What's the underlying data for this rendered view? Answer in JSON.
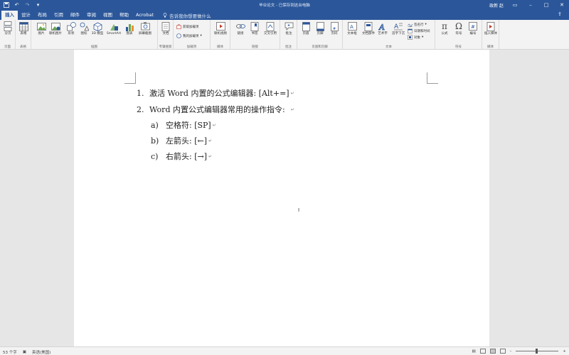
{
  "titlebar": {
    "doc_title": "毕业论文 - 已保存到这台电脑",
    "user": "政新 赵",
    "qat_icons": [
      "save-icon",
      "undo-icon",
      "redo-icon",
      "customize-icon"
    ]
  },
  "tabs": [
    "插入",
    "设计",
    "布局",
    "引用",
    "邮件",
    "审阅",
    "视图",
    "帮助",
    "Acrobat"
  ],
  "active_tab": "插入",
  "tellme": "告诉我你想要做什么",
  "ribbon": {
    "groups": {
      "pages": "页面",
      "tables": "表格",
      "illustrations": "插图",
      "addins": "加载项",
      "media": "媒体",
      "links": "链接",
      "comments": "批注",
      "header_footer": "页眉和页脚",
      "text": "文本",
      "symbols": "符号",
      "embed": "媒体",
      "acrobat_addins": "专辑搜索"
    },
    "buttons": {
      "pages": "分页",
      "table": "表格",
      "pictures": "图片",
      "online_pictures": "联机图片",
      "shapes": "形状",
      "icons": "图标",
      "models": "3D 模型",
      "smartart": "SmartArt",
      "chart": "图表",
      "screenshot": "屏幕截图",
      "docs": "文档",
      "get_addins": "获取加载项",
      "my_addins": "我的加载项",
      "online_video": "联机视频",
      "link": "链接",
      "bookmark": "书签",
      "cross_ref": "交叉引用",
      "comment": "批注",
      "header": "页眉",
      "footer": "页脚",
      "page_number": "页码",
      "textbox": "文本框",
      "quick_parts": "文档部件",
      "wordart": "艺术字",
      "dropcap": "首字下沉",
      "signature": "签名行",
      "datetime": "日期和时间",
      "object": "对象",
      "equation": "公式",
      "symbol": "符号",
      "number": "编号",
      "embed_media": "插入媒体"
    }
  },
  "document": {
    "list": [
      {
        "num": "1.",
        "text": "激活 Word 内置的公式编辑器: [Alt+=]"
      },
      {
        "num": "2.",
        "text": "Word 内置公式编辑器常用的操作指令:"
      }
    ],
    "sublist": [
      {
        "num": "a)",
        "text": "空格符: [SP]"
      },
      {
        "num": "b)",
        "text": "左箭头: [←]"
      },
      {
        "num": "c)",
        "text": "右箭头: [→]"
      }
    ],
    "para_mark": "↵"
  },
  "statusbar": {
    "word_count": "53 个字",
    "language": "英语(美国)"
  }
}
